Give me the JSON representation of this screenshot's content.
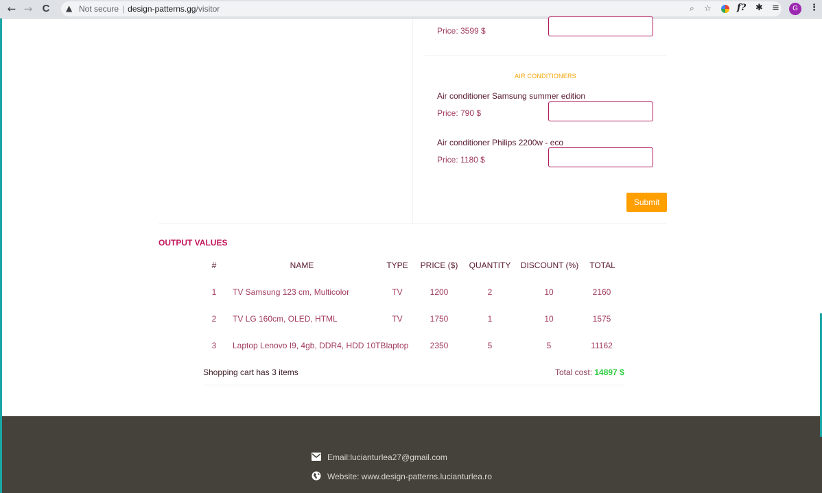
{
  "browser": {
    "nav": {
      "back_icon": "←",
      "forward_icon": "→",
      "reload_icon": "C"
    },
    "security_label": "Not secure",
    "url_host": "design-patterns.gg",
    "url_path": "/visitor",
    "avatar_letter": "G"
  },
  "products": {
    "first_price": "Price: 3599 $",
    "category": "AIR CONDITIONERS",
    "items": [
      {
        "name": "Air conditioner Samsung summer edition",
        "price": "Price: 790 $"
      },
      {
        "name": "Air conditioner Philips 2200w - eco",
        "price": "Price: 1180 $"
      }
    ],
    "submit_label": "Submit"
  },
  "output": {
    "title": "OUTPUT VALUES",
    "headers": [
      "#",
      "NAME",
      "TYPE",
      "PRICE ($)",
      "QUANTITY",
      "DISCOUNT (%)",
      "TOTAL"
    ],
    "rows": [
      [
        "1",
        "TV Samsung 123 cm, Multicolor",
        "TV",
        "1200",
        "2",
        "10",
        "2160"
      ],
      [
        "2",
        "TV LG 160cm, OLED, HTML",
        "TV",
        "1750",
        "1",
        "10",
        "1575"
      ],
      [
        "3",
        "Laptop Lenovo I9, 4gb, DDR4, HDD 10TB",
        "laptop",
        "2350",
        "5",
        "5",
        "11162"
      ]
    ],
    "cart_info": "Shopping cart has 3 items",
    "total_label": "Total cost: ",
    "total_value": "14897 $"
  },
  "footer": {
    "email": "Email:lucianturlea27@gmail.com",
    "website": "Website: www.design-patterns.lucianturlea.ro"
  },
  "colors": {
    "accent": "#ff9f00",
    "input_border": "#b0195a",
    "output_title": "#c2185b",
    "total_value": "#2ecc40",
    "footer_bg": "#45413b"
  }
}
